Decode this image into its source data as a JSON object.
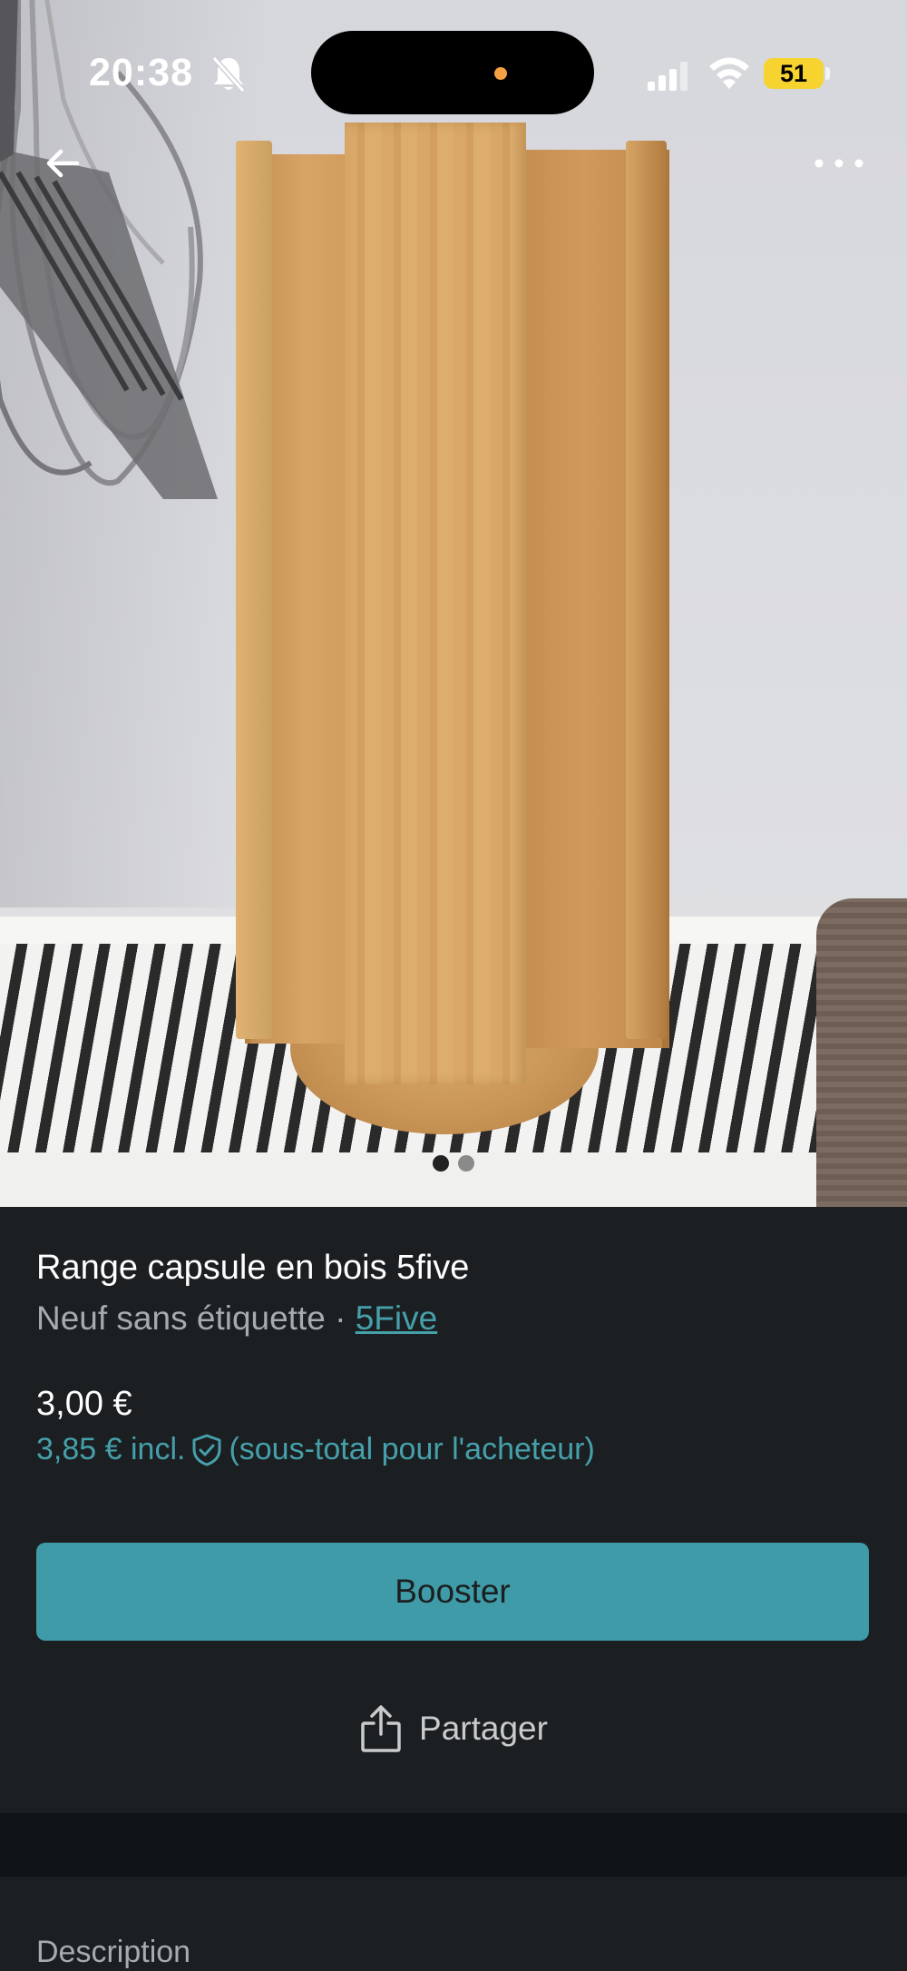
{
  "status_bar": {
    "time": "20:38",
    "battery": "51",
    "icons": [
      "bell-slash-icon",
      "signal-icon",
      "wifi-icon",
      "battery-icon"
    ]
  },
  "nav": {
    "back_icon": "arrow-left-icon",
    "more_icon": "more-horizontal-icon"
  },
  "gallery": {
    "page_count": 2,
    "current_page": 1
  },
  "item": {
    "title": "Range capsule en bois 5five",
    "condition": "Neuf sans étiquette · ",
    "brand": "5Five",
    "price": "3,00 €",
    "price_incl": "3,85 € incl.",
    "price_incl_note": "(sous-total pour l'acheteur)"
  },
  "actions": {
    "booster_label": "Booster",
    "share_label": "Partager"
  },
  "sections": {
    "description_label": "Description"
  },
  "colors": {
    "accent": "#3f9ba7",
    "link": "#46a0ab",
    "background": "#1b1f21"
  }
}
